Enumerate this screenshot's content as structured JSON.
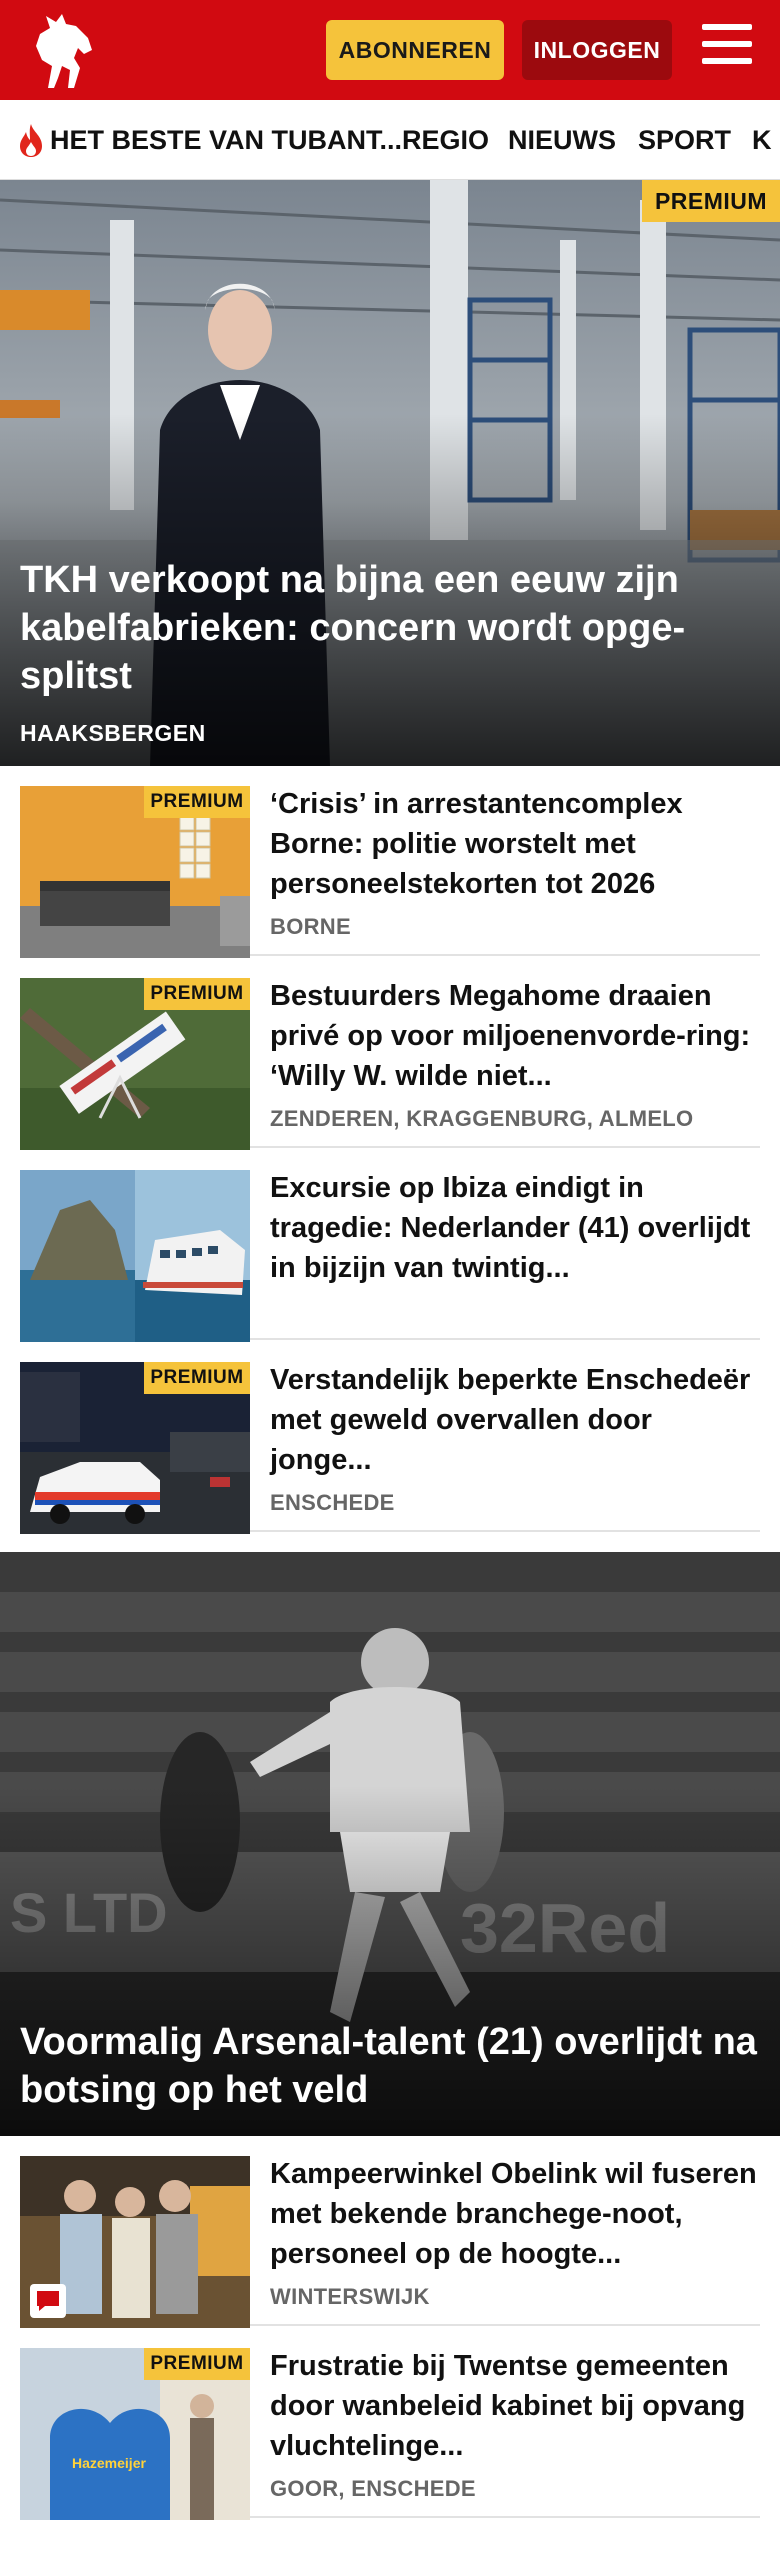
{
  "header": {
    "logo_icon": "tubantia-horse-logo",
    "subscribe_label": "ABONNEREN",
    "login_label": "INLOGGEN",
    "menu_icon": "hamburger-menu-icon",
    "brand_color": "#d10a11",
    "accent_color": "#f5c33b"
  },
  "nav": {
    "items": [
      {
        "label": "HET BESTE VAN TUBANT...",
        "icon": "flame-icon"
      },
      {
        "label": "REGIO"
      },
      {
        "label": "NIEUWS"
      },
      {
        "label": "SPORT"
      },
      {
        "label": "K"
      }
    ]
  },
  "premium_label": "PREMIUM",
  "hero1": {
    "title": "TKH verkoopt na bijna een eeuw zijn kabelfabrieken: concern wordt opge-splitst",
    "location": "HAAKSBERGEN",
    "premium": true
  },
  "articles_a": [
    {
      "title": "‘Crisis’ in arrestantencomplex Borne: politie worstelt met personeelstekorten tot 2026",
      "location": "BORNE",
      "premium": true
    },
    {
      "title": "Bestuurders Megahome draaien privé op voor miljoenenvorde-ring: ‘Willy W. wilde niet...",
      "location": "ZENDEREN, KRAGGENBURG, ALMELO",
      "premium": true
    },
    {
      "title": "Excursie op Ibiza eindigt in tragedie: Nederlander (41) overlijdt in bijzijn van twintig...",
      "location": "",
      "premium": false
    },
    {
      "title": "Verstandelijk beperkte Enschedeër met geweld overvallen door jonge...",
      "location": "ENSCHEDE",
      "premium": true
    }
  ],
  "hero2": {
    "title": "Voormalig Arsenal-talent (21) overlijdt na botsing op het veld"
  },
  "articles_b": [
    {
      "title": "Kampeerwinkel Obelink wil fuseren met bekende branchege-noot, personeel op de hoogte...",
      "location": "WINTERSWIJK",
      "premium": false,
      "comments": true
    },
    {
      "title": "Frustratie bij Twentse gemeenten door wanbeleid kabinet bij opvang vluchtelinge...",
      "location": "GOOR, ENSCHEDE",
      "premium": true
    }
  ]
}
